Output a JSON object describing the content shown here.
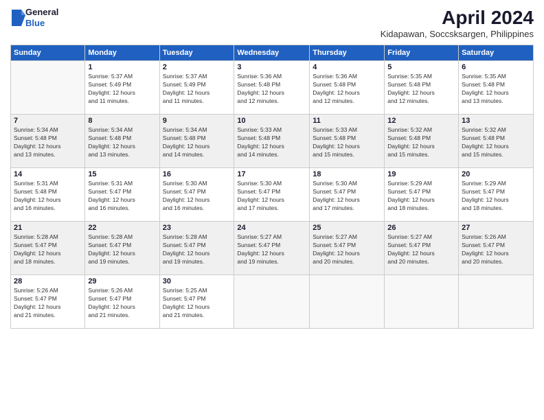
{
  "header": {
    "logo_general": "General",
    "logo_blue": "Blue",
    "month_title": "April 2024",
    "location": "Kidapawan, Soccsksargen, Philippines"
  },
  "days_of_week": [
    "Sunday",
    "Monday",
    "Tuesday",
    "Wednesday",
    "Thursday",
    "Friday",
    "Saturday"
  ],
  "weeks": [
    [
      {
        "day": "",
        "info": ""
      },
      {
        "day": "1",
        "info": "Sunrise: 5:37 AM\nSunset: 5:49 PM\nDaylight: 12 hours\nand 11 minutes."
      },
      {
        "day": "2",
        "info": "Sunrise: 5:37 AM\nSunset: 5:49 PM\nDaylight: 12 hours\nand 11 minutes."
      },
      {
        "day": "3",
        "info": "Sunrise: 5:36 AM\nSunset: 5:48 PM\nDaylight: 12 hours\nand 12 minutes."
      },
      {
        "day": "4",
        "info": "Sunrise: 5:36 AM\nSunset: 5:48 PM\nDaylight: 12 hours\nand 12 minutes."
      },
      {
        "day": "5",
        "info": "Sunrise: 5:35 AM\nSunset: 5:48 PM\nDaylight: 12 hours\nand 12 minutes."
      },
      {
        "day": "6",
        "info": "Sunrise: 5:35 AM\nSunset: 5:48 PM\nDaylight: 12 hours\nand 13 minutes."
      }
    ],
    [
      {
        "day": "7",
        "info": "Sunrise: 5:34 AM\nSunset: 5:48 PM\nDaylight: 12 hours\nand 13 minutes."
      },
      {
        "day": "8",
        "info": "Sunrise: 5:34 AM\nSunset: 5:48 PM\nDaylight: 12 hours\nand 13 minutes."
      },
      {
        "day": "9",
        "info": "Sunrise: 5:34 AM\nSunset: 5:48 PM\nDaylight: 12 hours\nand 14 minutes."
      },
      {
        "day": "10",
        "info": "Sunrise: 5:33 AM\nSunset: 5:48 PM\nDaylight: 12 hours\nand 14 minutes."
      },
      {
        "day": "11",
        "info": "Sunrise: 5:33 AM\nSunset: 5:48 PM\nDaylight: 12 hours\nand 15 minutes."
      },
      {
        "day": "12",
        "info": "Sunrise: 5:32 AM\nSunset: 5:48 PM\nDaylight: 12 hours\nand 15 minutes."
      },
      {
        "day": "13",
        "info": "Sunrise: 5:32 AM\nSunset: 5:48 PM\nDaylight: 12 hours\nand 15 minutes."
      }
    ],
    [
      {
        "day": "14",
        "info": "Sunrise: 5:31 AM\nSunset: 5:48 PM\nDaylight: 12 hours\nand 16 minutes."
      },
      {
        "day": "15",
        "info": "Sunrise: 5:31 AM\nSunset: 5:47 PM\nDaylight: 12 hours\nand 16 minutes."
      },
      {
        "day": "16",
        "info": "Sunrise: 5:30 AM\nSunset: 5:47 PM\nDaylight: 12 hours\nand 16 minutes."
      },
      {
        "day": "17",
        "info": "Sunrise: 5:30 AM\nSunset: 5:47 PM\nDaylight: 12 hours\nand 17 minutes."
      },
      {
        "day": "18",
        "info": "Sunrise: 5:30 AM\nSunset: 5:47 PM\nDaylight: 12 hours\nand 17 minutes."
      },
      {
        "day": "19",
        "info": "Sunrise: 5:29 AM\nSunset: 5:47 PM\nDaylight: 12 hours\nand 18 minutes."
      },
      {
        "day": "20",
        "info": "Sunrise: 5:29 AM\nSunset: 5:47 PM\nDaylight: 12 hours\nand 18 minutes."
      }
    ],
    [
      {
        "day": "21",
        "info": "Sunrise: 5:28 AM\nSunset: 5:47 PM\nDaylight: 12 hours\nand 18 minutes."
      },
      {
        "day": "22",
        "info": "Sunrise: 5:28 AM\nSunset: 5:47 PM\nDaylight: 12 hours\nand 19 minutes."
      },
      {
        "day": "23",
        "info": "Sunrise: 5:28 AM\nSunset: 5:47 PM\nDaylight: 12 hours\nand 19 minutes."
      },
      {
        "day": "24",
        "info": "Sunrise: 5:27 AM\nSunset: 5:47 PM\nDaylight: 12 hours\nand 19 minutes."
      },
      {
        "day": "25",
        "info": "Sunrise: 5:27 AM\nSunset: 5:47 PM\nDaylight: 12 hours\nand 20 minutes."
      },
      {
        "day": "26",
        "info": "Sunrise: 5:27 AM\nSunset: 5:47 PM\nDaylight: 12 hours\nand 20 minutes."
      },
      {
        "day": "27",
        "info": "Sunrise: 5:26 AM\nSunset: 5:47 PM\nDaylight: 12 hours\nand 20 minutes."
      }
    ],
    [
      {
        "day": "28",
        "info": "Sunrise: 5:26 AM\nSunset: 5:47 PM\nDaylight: 12 hours\nand 21 minutes."
      },
      {
        "day": "29",
        "info": "Sunrise: 5:26 AM\nSunset: 5:47 PM\nDaylight: 12 hours\nand 21 minutes."
      },
      {
        "day": "30",
        "info": "Sunrise: 5:25 AM\nSunset: 5:47 PM\nDaylight: 12 hours\nand 21 minutes."
      },
      {
        "day": "",
        "info": ""
      },
      {
        "day": "",
        "info": ""
      },
      {
        "day": "",
        "info": ""
      },
      {
        "day": "",
        "info": ""
      }
    ]
  ]
}
